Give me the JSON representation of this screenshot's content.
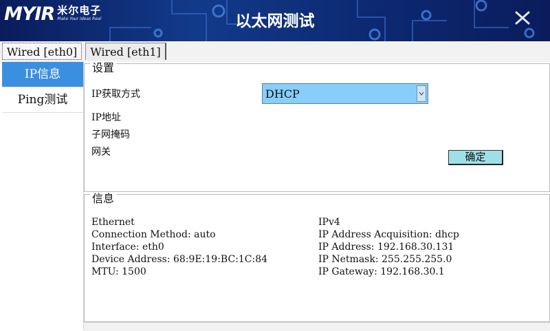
{
  "header": {
    "logo_mark": "MYIR",
    "logo_cn": "米尔电子",
    "logo_tagline": "Make Your Ideas Real",
    "title": "以太网测试"
  },
  "tabs": [
    {
      "label": "Wired [eth0]",
      "selected": true
    },
    {
      "label": "Wired [eth1]",
      "selected": false
    }
  ],
  "nav": [
    {
      "label": "IP信息",
      "active": true
    },
    {
      "label": "Ping测试",
      "active": false
    }
  ],
  "settings": {
    "legend": "设置",
    "ip_method_label": "IP获取方式",
    "ip_method_value": "DHCP",
    "ip_address_label": "IP地址",
    "subnet_label": "子网掩码",
    "gateway_label": "网关",
    "confirm_label": "确定"
  },
  "info": {
    "legend": "信息",
    "left": [
      "Ethernet",
      "Connection Method: auto",
      "Interface: eth0",
      "Device Address: 68:9E:19:BC:1C:84",
      "MTU: 1500"
    ],
    "right": [
      "IPv4",
      "IP Address Acquisition: dhcp",
      "IP Address: 192.168.30.131",
      "IP Netmask: 255.255.255.0",
      "IP Gateway: 192.168.30.1"
    ]
  },
  "colors": {
    "header_bg": "#0d2a74",
    "nav_active": "#3b8fe0",
    "select_bg": "#87cefa",
    "button_bg": "#9fe0e8"
  }
}
